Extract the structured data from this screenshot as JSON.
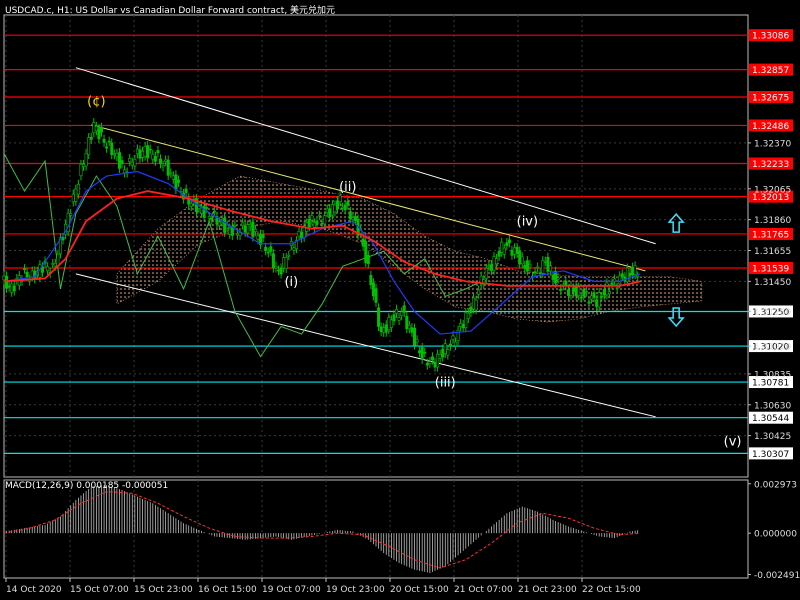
{
  "header": {
    "title": "USDCAD.c, H1:  US Dollar vs Canadian Dollar Forward contract, 美元兑加元"
  },
  "colors": {
    "background": "#000000",
    "grid": "#3a3a3a",
    "bull_candle": "#00c000",
    "bear_candle": "#00c000",
    "price_line_red": "#ff0000",
    "level_red": "#ff0000",
    "level_cyan": "#00e5ee",
    "label_red_bg": "#ff0000",
    "label_cyan_bg": "#ffffff",
    "wave_label": "#ffffff",
    "wave_label_top": "#ffd400",
    "channel": "#ffffff",
    "trendline_yellow": "#e8e870",
    "ma_blue": "#1e3cff",
    "ma_red": "#ff2020",
    "chikou": "#40c040",
    "cloud": "#f0b080",
    "macd_hist": "#c0c0c0",
    "macd_signal": "#ff3030",
    "arrow": "#40e0ff"
  },
  "chart_data": {
    "type": "line",
    "title": "USDCAD.c, H1:  US Dollar vs Canadian Dollar Forward contract, 美元兑加元",
    "price_axis": {
      "ylim": [
        1.3015,
        1.3322
      ],
      "ticks": [
        1.3237,
        1.32065,
        1.3186,
        1.31655,
        1.3145,
        1.3125,
        1.3102,
        1.30835,
        1.3063,
        1.30425
      ]
    },
    "time_axis": {
      "tick_labels": [
        "14 Oct 2020",
        "15 Oct 07:00",
        "15 Oct 23:00",
        "16 Oct 15:00",
        "19 Oct 07:00",
        "19 Oct 23:00",
        "20 Oct 15:00",
        "21 Oct 07:00",
        "21 Oct 23:00",
        "22 Oct 15:00"
      ]
    },
    "levels_red": [
      1.33086,
      1.32857,
      1.32675,
      1.32486,
      1.32233,
      1.32013,
      1.31765,
      1.31539
    ],
    "levels_cyan": [
      1.3125,
      1.3102,
      1.30781,
      1.30544,
      1.30307
    ],
    "price_series": [
      [
        0,
        1.3146
      ],
      [
        4,
        1.314
      ],
      [
        8,
        1.315
      ],
      [
        12,
        1.3148
      ],
      [
        16,
        1.3155
      ],
      [
        20,
        1.3153
      ],
      [
        24,
        1.3176
      ],
      [
        28,
        1.32
      ],
      [
        32,
        1.3225
      ],
      [
        36,
        1.3249
      ],
      [
        40,
        1.3238
      ],
      [
        44,
        1.323
      ],
      [
        48,
        1.3218
      ],
      [
        52,
        1.3228
      ],
      [
        56,
        1.3232
      ],
      [
        60,
        1.3228
      ],
      [
        64,
        1.3222
      ],
      [
        68,
        1.321
      ],
      [
        72,
        1.32
      ],
      [
        76,
        1.3195
      ],
      [
        80,
        1.319
      ],
      [
        84,
        1.3186
      ],
      [
        88,
        1.318
      ],
      [
        92,
        1.3178
      ],
      [
        96,
        1.3182
      ],
      [
        100,
        1.3175
      ],
      [
        104,
        1.3165
      ],
      [
        108,
        1.315
      ],
      [
        112,
        1.3165
      ],
      [
        116,
        1.3175
      ],
      [
        120,
        1.3185
      ],
      [
        124,
        1.3185
      ],
      [
        128,
        1.3192
      ],
      [
        132,
        1.3198
      ],
      [
        136,
        1.319
      ],
      [
        140,
        1.3176
      ],
      [
        144,
        1.3145
      ],
      [
        148,
        1.311
      ],
      [
        152,
        1.312
      ],
      [
        156,
        1.3125
      ],
      [
        160,
        1.311
      ],
      [
        164,
        1.3095
      ],
      [
        168,
        1.309
      ],
      [
        172,
        1.3098
      ],
      [
        176,
        1.3105
      ],
      [
        180,
        1.3118
      ],
      [
        184,
        1.313
      ],
      [
        188,
        1.315
      ],
      [
        192,
        1.3158
      ],
      [
        196,
        1.317
      ],
      [
        200,
        1.3165
      ],
      [
        204,
        1.3155
      ],
      [
        208,
        1.315
      ],
      [
        212,
        1.3158
      ],
      [
        216,
        1.3145
      ],
      [
        220,
        1.314
      ],
      [
        224,
        1.3138
      ],
      [
        228,
        1.3135
      ],
      [
        232,
        1.3132
      ],
      [
        236,
        1.314
      ],
      [
        240,
        1.3145
      ],
      [
        244,
        1.315
      ],
      [
        248,
        1.3152
      ]
    ],
    "ma_blue": [
      [
        0,
        1.3145
      ],
      [
        12,
        1.3148
      ],
      [
        24,
        1.3178
      ],
      [
        32,
        1.3205
      ],
      [
        40,
        1.3215
      ],
      [
        52,
        1.3218
      ],
      [
        64,
        1.321
      ],
      [
        76,
        1.3195
      ],
      [
        88,
        1.3182
      ],
      [
        100,
        1.317
      ],
      [
        112,
        1.317
      ],
      [
        124,
        1.318
      ],
      [
        136,
        1.3185
      ],
      [
        144,
        1.317
      ],
      [
        152,
        1.3145
      ],
      [
        160,
        1.3125
      ],
      [
        170,
        1.311
      ],
      [
        182,
        1.3112
      ],
      [
        194,
        1.313
      ],
      [
        206,
        1.3148
      ],
      [
        218,
        1.3152
      ],
      [
        230,
        1.3145
      ],
      [
        240,
        1.3145
      ],
      [
        248,
        1.315
      ]
    ],
    "ma_red": [
      [
        0,
        1.3145
      ],
      [
        16,
        1.3147
      ],
      [
        24,
        1.316
      ],
      [
        32,
        1.3185
      ],
      [
        44,
        1.32
      ],
      [
        56,
        1.3205
      ],
      [
        72,
        1.32
      ],
      [
        88,
        1.3192
      ],
      [
        104,
        1.3185
      ],
      [
        120,
        1.318
      ],
      [
        132,
        1.3182
      ],
      [
        144,
        1.3172
      ],
      [
        156,
        1.3158
      ],
      [
        168,
        1.315
      ],
      [
        180,
        1.3145
      ],
      [
        196,
        1.3142
      ],
      [
        212,
        1.3142
      ],
      [
        228,
        1.3142
      ],
      [
        240,
        1.3142
      ],
      [
        248,
        1.3145
      ]
    ],
    "chikou": [
      [
        0,
        1.323
      ],
      [
        8,
        1.3205
      ],
      [
        16,
        1.3225
      ],
      [
        22,
        1.314
      ],
      [
        28,
        1.319
      ],
      [
        36,
        1.3215
      ],
      [
        44,
        1.3195
      ],
      [
        52,
        1.315
      ],
      [
        60,
        1.3175
      ],
      [
        70,
        1.314
      ],
      [
        80,
        1.3185
      ],
      [
        90,
        1.3125
      ],
      [
        100,
        1.3095
      ],
      [
        108,
        1.3115
      ],
      [
        116,
        1.311
      ],
      [
        124,
        1.313
      ],
      [
        132,
        1.3155
      ],
      [
        140,
        1.316
      ],
      [
        148,
        1.3165
      ],
      [
        156,
        1.315
      ],
      [
        164,
        1.316
      ],
      [
        172,
        1.3135
      ],
      [
        180,
        1.314
      ],
      [
        186,
        1.3145
      ]
    ],
    "cloud_upper": [
      [
        44,
        1.315
      ],
      [
        60,
        1.318
      ],
      [
        76,
        1.32
      ],
      [
        92,
        1.3215
      ],
      [
        108,
        1.321
      ],
      [
        124,
        1.3205
      ],
      [
        140,
        1.32
      ],
      [
        152,
        1.319
      ],
      [
        164,
        1.3175
      ],
      [
        176,
        1.3165
      ],
      [
        188,
        1.316
      ],
      [
        200,
        1.3152
      ],
      [
        212,
        1.315
      ],
      [
        224,
        1.3148
      ],
      [
        236,
        1.3148
      ],
      [
        248,
        1.3148
      ],
      [
        260,
        1.3148
      ],
      [
        272,
        1.3145
      ]
    ],
    "cloud_lower": [
      [
        44,
        1.313
      ],
      [
        60,
        1.3145
      ],
      [
        76,
        1.317
      ],
      [
        92,
        1.318
      ],
      [
        108,
        1.3185
      ],
      [
        124,
        1.318
      ],
      [
        140,
        1.317
      ],
      [
        152,
        1.3155
      ],
      [
        164,
        1.314
      ],
      [
        176,
        1.3128
      ],
      [
        188,
        1.3125
      ],
      [
        200,
        1.312
      ],
      [
        212,
        1.3118
      ],
      [
        224,
        1.312
      ],
      [
        236,
        1.3125
      ],
      [
        248,
        1.3128
      ],
      [
        260,
        1.313
      ],
      [
        272,
        1.3132
      ]
    ],
    "channel_lines": [
      {
        "from": [
          28,
          1.3287
        ],
        "to": [
          254,
          1.317
        ]
      },
      {
        "from": [
          34,
          1.3249
        ],
        "to": [
          250,
          1.3152
        ]
      },
      {
        "from": [
          28,
          1.315
        ],
        "to": [
          254,
          1.3055
        ]
      }
    ],
    "wave_labels": [
      {
        "text": "(¢)",
        "x": 36,
        "price": 1.3262,
        "color": "top"
      },
      {
        "text": "(ii)",
        "x": 134,
        "price": 1.3205
      },
      {
        "text": "(i)",
        "x": 112,
        "price": 1.3142
      },
      {
        "text": "(iii)",
        "x": 172,
        "price": 1.3075
      },
      {
        "text": "(iv)",
        "x": 204,
        "price": 1.3182
      },
      {
        "text": "(v)",
        "x": 284,
        "price": 1.3036
      }
    ],
    "arrows": [
      {
        "dir": "up",
        "x": 262,
        "price": 1.3183
      },
      {
        "dir": "down",
        "x": 262,
        "price": 1.3122
      }
    ],
    "macd": {
      "label": "MACD(12,26,9) 0.000185 -0.000051",
      "ticks": [
        0.002973,
        0.0,
        -0.002491
      ],
      "range": [
        -0.0027,
        0.0032
      ],
      "histogram": [
        [
          0,
          0.0001
        ],
        [
          8,
          0.0003
        ],
        [
          16,
          0.0005
        ],
        [
          22,
          0.001
        ],
        [
          28,
          0.002
        ],
        [
          34,
          0.0028
        ],
        [
          40,
          0.0029
        ],
        [
          46,
          0.0026
        ],
        [
          52,
          0.0022
        ],
        [
          58,
          0.0018
        ],
        [
          64,
          0.0012
        ],
        [
          70,
          0.0006
        ],
        [
          76,
          0.0002
        ],
        [
          82,
          -0.0002
        ],
        [
          88,
          -0.0003
        ],
        [
          94,
          -0.0004
        ],
        [
          100,
          -0.0003
        ],
        [
          106,
          -0.0002
        ],
        [
          112,
          -0.0004
        ],
        [
          118,
          -0.0002
        ],
        [
          124,
          0.0
        ],
        [
          130,
          0.0002
        ],
        [
          136,
          0.0001
        ],
        [
          142,
          -0.0004
        ],
        [
          148,
          -0.0012
        ],
        [
          154,
          -0.0018
        ],
        [
          160,
          -0.0022
        ],
        [
          166,
          -0.0024
        ],
        [
          172,
          -0.002
        ],
        [
          178,
          -0.0012
        ],
        [
          184,
          -0.0004
        ],
        [
          190,
          0.0004
        ],
        [
          196,
          0.0012
        ],
        [
          202,
          0.0016
        ],
        [
          208,
          0.0013
        ],
        [
          214,
          0.0008
        ],
        [
          220,
          0.0004
        ],
        [
          226,
          0.0001
        ],
        [
          232,
          -0.0002
        ],
        [
          238,
          -0.0003
        ],
        [
          244,
          0.0001
        ],
        [
          248,
          0.0002
        ]
      ],
      "signal": [
        [
          0,
          0.0
        ],
        [
          10,
          0.0003
        ],
        [
          20,
          0.0008
        ],
        [
          30,
          0.0018
        ],
        [
          40,
          0.0025
        ],
        [
          50,
          0.0024
        ],
        [
          60,
          0.0018
        ],
        [
          70,
          0.001
        ],
        [
          80,
          0.0003
        ],
        [
          90,
          -0.0002
        ],
        [
          100,
          -0.0003
        ],
        [
          110,
          -0.0003
        ],
        [
          120,
          -0.0002
        ],
        [
          130,
          0.0
        ],
        [
          140,
          -0.0001
        ],
        [
          150,
          -0.0008
        ],
        [
          160,
          -0.0016
        ],
        [
          170,
          -0.0021
        ],
        [
          180,
          -0.0016
        ],
        [
          190,
          -0.0006
        ],
        [
          200,
          0.0006
        ],
        [
          210,
          0.0012
        ],
        [
          220,
          0.0009
        ],
        [
          230,
          0.0003
        ],
        [
          240,
          -0.0001
        ],
        [
          248,
          0.0
        ]
      ]
    }
  }
}
